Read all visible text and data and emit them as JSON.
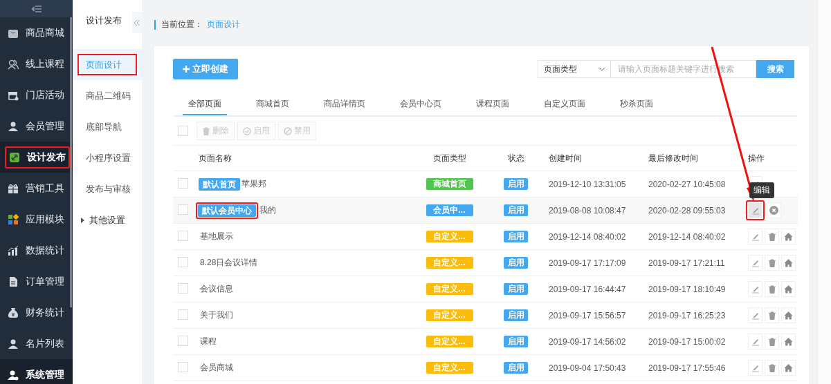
{
  "sidebar": {
    "items": [
      {
        "label": "商品商城",
        "selected": false,
        "hovered": false,
        "highlighted": false
      },
      {
        "label": "线上课程",
        "selected": false,
        "hovered": false,
        "highlighted": false
      },
      {
        "label": "门店活动",
        "selected": false,
        "hovered": false,
        "highlighted": false
      },
      {
        "label": "会员管理",
        "selected": false,
        "hovered": false,
        "highlighted": false
      },
      {
        "label": "设计发布",
        "selected": true,
        "hovered": false,
        "highlighted": true
      },
      {
        "label": "营销工具",
        "selected": false,
        "hovered": false,
        "highlighted": false
      },
      {
        "label": "应用模块",
        "selected": false,
        "hovered": false,
        "highlighted": false
      },
      {
        "label": "数据统计",
        "selected": false,
        "hovered": false,
        "highlighted": false
      },
      {
        "label": "订单管理",
        "selected": false,
        "hovered": false,
        "highlighted": false
      },
      {
        "label": "财务统计",
        "selected": false,
        "hovered": false,
        "highlighted": false
      },
      {
        "label": "名片列表",
        "selected": false,
        "hovered": false,
        "highlighted": false
      },
      {
        "label": "系统管理",
        "selected": false,
        "hovered": true,
        "highlighted": false
      }
    ]
  },
  "subnav": {
    "title": "设计发布",
    "items": [
      {
        "label": "页面设计",
        "kind": "link",
        "selected": true,
        "highlighted": true
      },
      {
        "label": "商品二维码",
        "kind": "link",
        "selected": false,
        "highlighted": false
      },
      {
        "label": "底部导航",
        "kind": "link",
        "selected": false,
        "highlighted": false
      },
      {
        "label": "小程序设置",
        "kind": "link",
        "selected": false,
        "highlighted": false
      },
      {
        "label": "发布与审核",
        "kind": "link",
        "selected": false,
        "highlighted": false
      },
      {
        "label": "其他设置",
        "kind": "group",
        "selected": false,
        "highlighted": false
      }
    ]
  },
  "breadcrumb": {
    "label": "当前位置：",
    "current": "页面设计"
  },
  "create_button": "立即创建",
  "filter": {
    "select": "页面类型",
    "placeholder": "请输入页面标题关键字进行搜索",
    "button": "搜索"
  },
  "tabs": [
    {
      "label": "全部页面",
      "selected": true
    },
    {
      "label": "商城首页",
      "selected": false
    },
    {
      "label": "商品详情页",
      "selected": false
    },
    {
      "label": "会员中心页",
      "selected": false
    },
    {
      "label": "课程页面",
      "selected": false
    },
    {
      "label": "自定义页面",
      "selected": false
    },
    {
      "label": "秒杀页面",
      "selected": false
    }
  ],
  "select_all_checked": false,
  "bulk_actions": [
    {
      "label": "删除",
      "disabled": true
    },
    {
      "label": "启用",
      "disabled": true
    },
    {
      "label": "禁用",
      "disabled": true
    }
  ],
  "table": {
    "columns": [
      "页面名称",
      "页面类型",
      "状态",
      "创建时间",
      "最后修改时间",
      "操作"
    ],
    "rows": [
      {
        "kind": "home",
        "checked": false,
        "default_tag": "默认首页",
        "name": "苹果邦",
        "type": "商城首页",
        "color": "#52c44f",
        "status": "启用",
        "created": "2019-12-10 13:31:05",
        "modified": "2020-02-27 10:45:08",
        "hovered": false,
        "highlighted": false
      },
      {
        "kind": "member",
        "checked": false,
        "default_tag": "默认会员中心",
        "name": "我的",
        "type": "会员中...",
        "color": "#43a8f0",
        "status": "启用",
        "created": "2019-08-08 10:08:47",
        "modified": "2020-02-28 09:55:03",
        "hovered": true,
        "highlighted": true,
        "tooltip": "编辑"
      },
      {
        "kind": "custom",
        "checked": false,
        "name": "基地展示",
        "type": "自定义...",
        "color": "#fcbd0a",
        "status": "启用",
        "created": "2019-12-14 08:40:02",
        "modified": "2019-12-14 08:40:02",
        "hovered": false,
        "highlighted": false
      },
      {
        "kind": "custom",
        "checked": false,
        "name": "8.28日会议详情",
        "type": "自定义...",
        "color": "#fcbd0a",
        "status": "启用",
        "created": "2019-09-17 17:17:09",
        "modified": "2019-09-17 17:21:11",
        "hovered": false,
        "highlighted": false
      },
      {
        "kind": "custom",
        "checked": false,
        "name": "会议信息",
        "type": "自定义...",
        "color": "#fcbd0a",
        "status": "启用",
        "created": "2019-09-17 16:44:47",
        "modified": "2019-09-17 18:10:49",
        "hovered": false,
        "highlighted": false
      },
      {
        "kind": "custom",
        "checked": false,
        "name": "关于我们",
        "type": "自定义...",
        "color": "#fcbd0a",
        "status": "启用",
        "created": "2019-09-17 15:56:57",
        "modified": "2019-09-17 16:25:23",
        "hovered": false,
        "highlighted": false
      },
      {
        "kind": "custom",
        "checked": false,
        "name": "课程",
        "type": "自定义...",
        "color": "#fcbd0a",
        "status": "启用",
        "created": "2019-09-17 14:56:02",
        "modified": "2019-09-17 15:00:02",
        "hovered": false,
        "highlighted": false
      },
      {
        "kind": "custom",
        "checked": false,
        "name": "会员商城",
        "type": "自定义...",
        "color": "#fcbd0a",
        "status": "启用",
        "created": "2019-09-04 17:50:43",
        "modified": "2019-09-17 17:55:46",
        "hovered": false,
        "highlighted": false
      }
    ]
  }
}
